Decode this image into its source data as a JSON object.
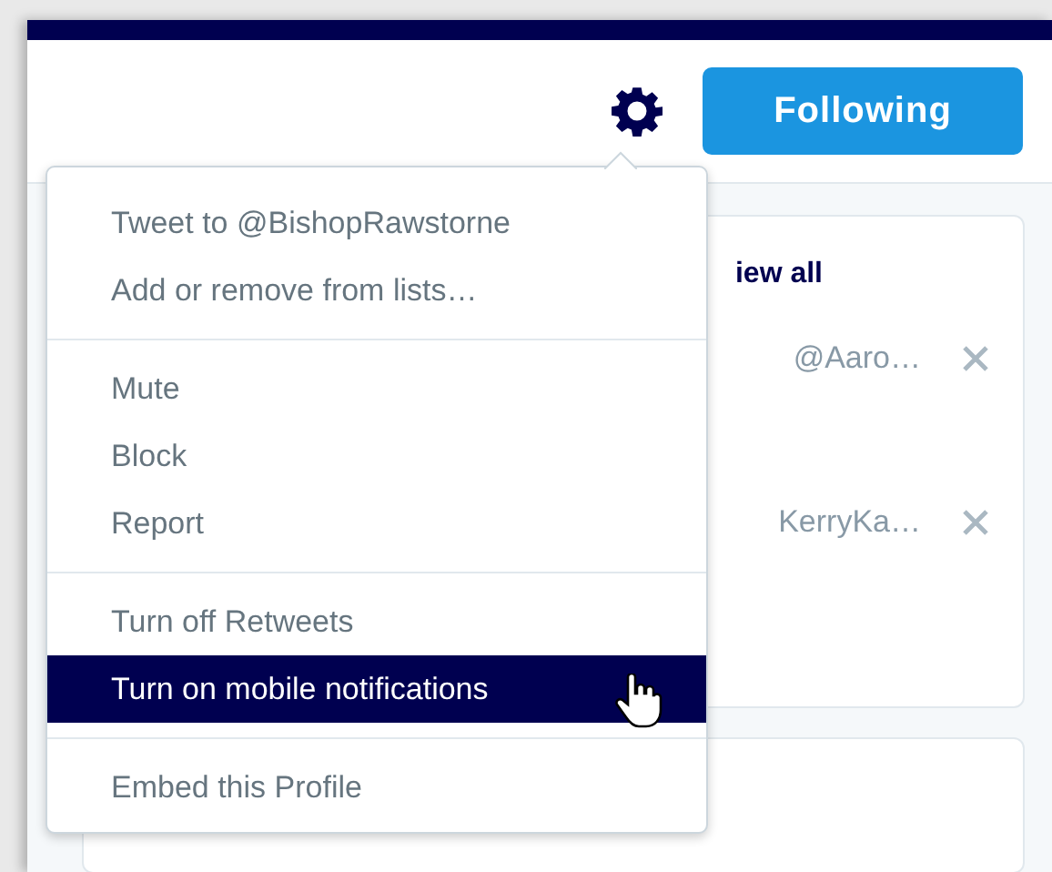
{
  "header": {
    "follow_button": "Following"
  },
  "menu": {
    "groups": [
      [
        {
          "label": "Tweet to @BishopRawstorne",
          "selected": false
        },
        {
          "label": "Add or remove from lists…",
          "selected": false
        }
      ],
      [
        {
          "label": "Mute",
          "selected": false
        },
        {
          "label": "Block",
          "selected": false
        },
        {
          "label": "Report",
          "selected": false
        }
      ],
      [
        {
          "label": "Turn off Retweets",
          "selected": false
        },
        {
          "label": "Turn on mobile notifications",
          "selected": true
        }
      ],
      [
        {
          "label": "Embed this Profile",
          "selected": false
        }
      ]
    ]
  },
  "who_to_follow": {
    "view_all": "iew all",
    "suggestions": [
      {
        "handle": "@Aaro…"
      },
      {
        "handle": "KerryKa…"
      }
    ]
  }
}
